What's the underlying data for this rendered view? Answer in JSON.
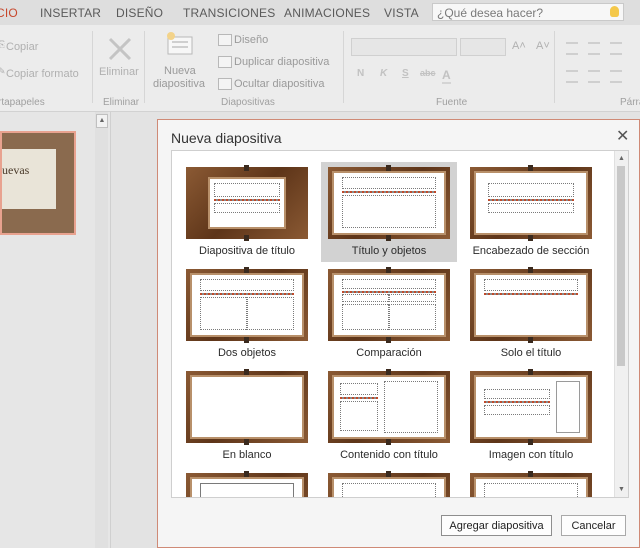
{
  "tabs": [
    {
      "label": "CIO",
      "active": true
    },
    {
      "label": "INSERTAR"
    },
    {
      "label": "DISEÑO"
    },
    {
      "label": "TRANSICIONES"
    },
    {
      "label": "ANIMACIONES"
    },
    {
      "label": "VISTA"
    }
  ],
  "tell_me": {
    "placeholder": "¿Qué desea hacer?"
  },
  "ribbon": {
    "clipboard": {
      "copy": "Copiar",
      "copy_format": "Copiar formato",
      "group": "rtapapeles"
    },
    "delete": {
      "label": "Eliminar",
      "group": "Eliminar"
    },
    "slides": {
      "new_slide": "Nueva",
      "new_slide_2": "diapositiva",
      "layout": "Diseño",
      "duplicate": "Duplicar diapositiva",
      "hide": "Ocultar diapositiva",
      "group": "Diapositivas"
    },
    "font": {
      "group": "Fuente",
      "bold": "N",
      "italic": "K",
      "underline": "S",
      "strike": "abc",
      "color": "A"
    },
    "paragraph": {
      "group": "Párra"
    }
  },
  "thumbnail": {
    "text": "uevas"
  },
  "dialog": {
    "title": "Nueva diapositiva",
    "close_glyph": "✕",
    "layouts": [
      {
        "label": "Diapositiva de título",
        "selected": false
      },
      {
        "label": "Título y objetos",
        "selected": true
      },
      {
        "label": "Encabezado de sección",
        "selected": false
      },
      {
        "label": "Dos objetos",
        "selected": false
      },
      {
        "label": "Comparación",
        "selected": false
      },
      {
        "label": "Solo el título",
        "selected": false
      },
      {
        "label": "En blanco",
        "selected": false
      },
      {
        "label": "Contenido con título",
        "selected": false
      },
      {
        "label": "Imagen con título",
        "selected": false
      }
    ],
    "add_button": "Agregar diapositiva",
    "cancel_button": "Cancelar"
  },
  "colors": {
    "accent": "#c7472c",
    "frame": "#6b3f22",
    "selected_tile": "#d2d2d2"
  }
}
